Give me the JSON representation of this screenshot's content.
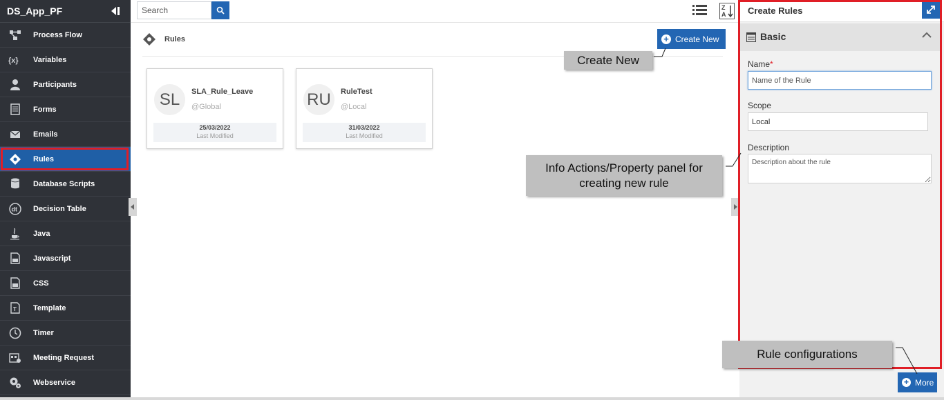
{
  "app": {
    "title": "DS_App_PF"
  },
  "sidebar": {
    "items": [
      {
        "label": "Process Flow",
        "icon": "process-flow-icon"
      },
      {
        "label": "Variables",
        "icon": "variables-icon"
      },
      {
        "label": "Participants",
        "icon": "participants-icon"
      },
      {
        "label": "Forms",
        "icon": "forms-icon"
      },
      {
        "label": "Emails",
        "icon": "email-icon"
      },
      {
        "label": "Rules",
        "icon": "rules-icon",
        "active": true
      },
      {
        "label": "Database Scripts",
        "icon": "database-icon"
      },
      {
        "label": "Decision Table",
        "icon": "decision-table-icon"
      },
      {
        "label": "Java",
        "icon": "java-icon"
      },
      {
        "label": "Javascript",
        "icon": "javascript-icon"
      },
      {
        "label": "CSS",
        "icon": "css-icon"
      },
      {
        "label": "Template",
        "icon": "template-icon"
      },
      {
        "label": "Timer",
        "icon": "timer-icon"
      },
      {
        "label": "Meeting Request",
        "icon": "meeting-request-icon"
      },
      {
        "label": "Webservice",
        "icon": "webservice-icon"
      }
    ]
  },
  "search": {
    "placeholder": "Search"
  },
  "main": {
    "breadcrumb": "Rules",
    "create_label": "Create New",
    "cards": [
      {
        "initials": "SL",
        "name": "SLA_Rule_Leave",
        "scope": "@Global",
        "date": "25/03/2022",
        "modified_label": "Last Modified"
      },
      {
        "initials": "RU",
        "name": "RuleTest",
        "scope": "@Local",
        "date": "31/03/2022",
        "modified_label": "Last Modified"
      }
    ]
  },
  "panel": {
    "title": "Create Rules",
    "section": "Basic",
    "name_label": "Name",
    "required_mark": "*",
    "name_placeholder": "Name of the Rule",
    "scope_label": "Scope",
    "scope_value": "Local",
    "description_label": "Description",
    "description_placeholder": "Description about the rule",
    "more_label": "More"
  },
  "callouts": {
    "create_new": "Create New",
    "info_panel": "Info Actions/Property panel for creating new rule",
    "rule_config": "Rule configurations"
  },
  "colors": {
    "accent": "#2366b3",
    "sidebar": "#2f3238",
    "highlight": "#e01e26",
    "callout": "#bfbfbf"
  }
}
